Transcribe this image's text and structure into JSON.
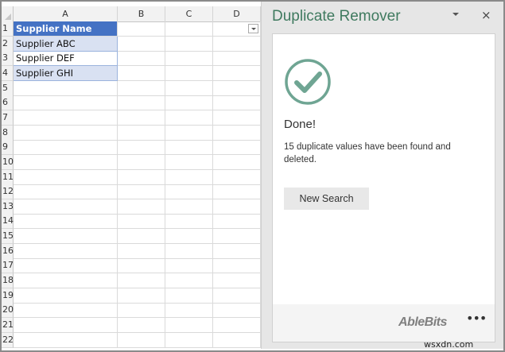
{
  "sheet": {
    "columns": [
      "A",
      "B",
      "C",
      "D"
    ],
    "rows": [
      "1",
      "2",
      "3",
      "4",
      "5",
      "6",
      "7",
      "8",
      "9",
      "10",
      "11",
      "12",
      "13",
      "14",
      "15",
      "16",
      "17",
      "18",
      "19",
      "20",
      "21",
      "22"
    ],
    "table": {
      "header": "Supplier Name",
      "values": [
        "Supplier ABC",
        "Supplier DEF",
        "Supplier GHI"
      ]
    },
    "header_color": "#4472c4",
    "band_color": "#d9e1f2"
  },
  "pane": {
    "title": "Duplicate Remover",
    "close_label": "×",
    "status_title": "Done!",
    "message": "15 duplicate values have been found and deleted.",
    "new_search_label": "New Search",
    "brand": "AbleBits",
    "more_label": "•••",
    "accent": "#5f9c88"
  },
  "watermark": "wsxdn.com"
}
